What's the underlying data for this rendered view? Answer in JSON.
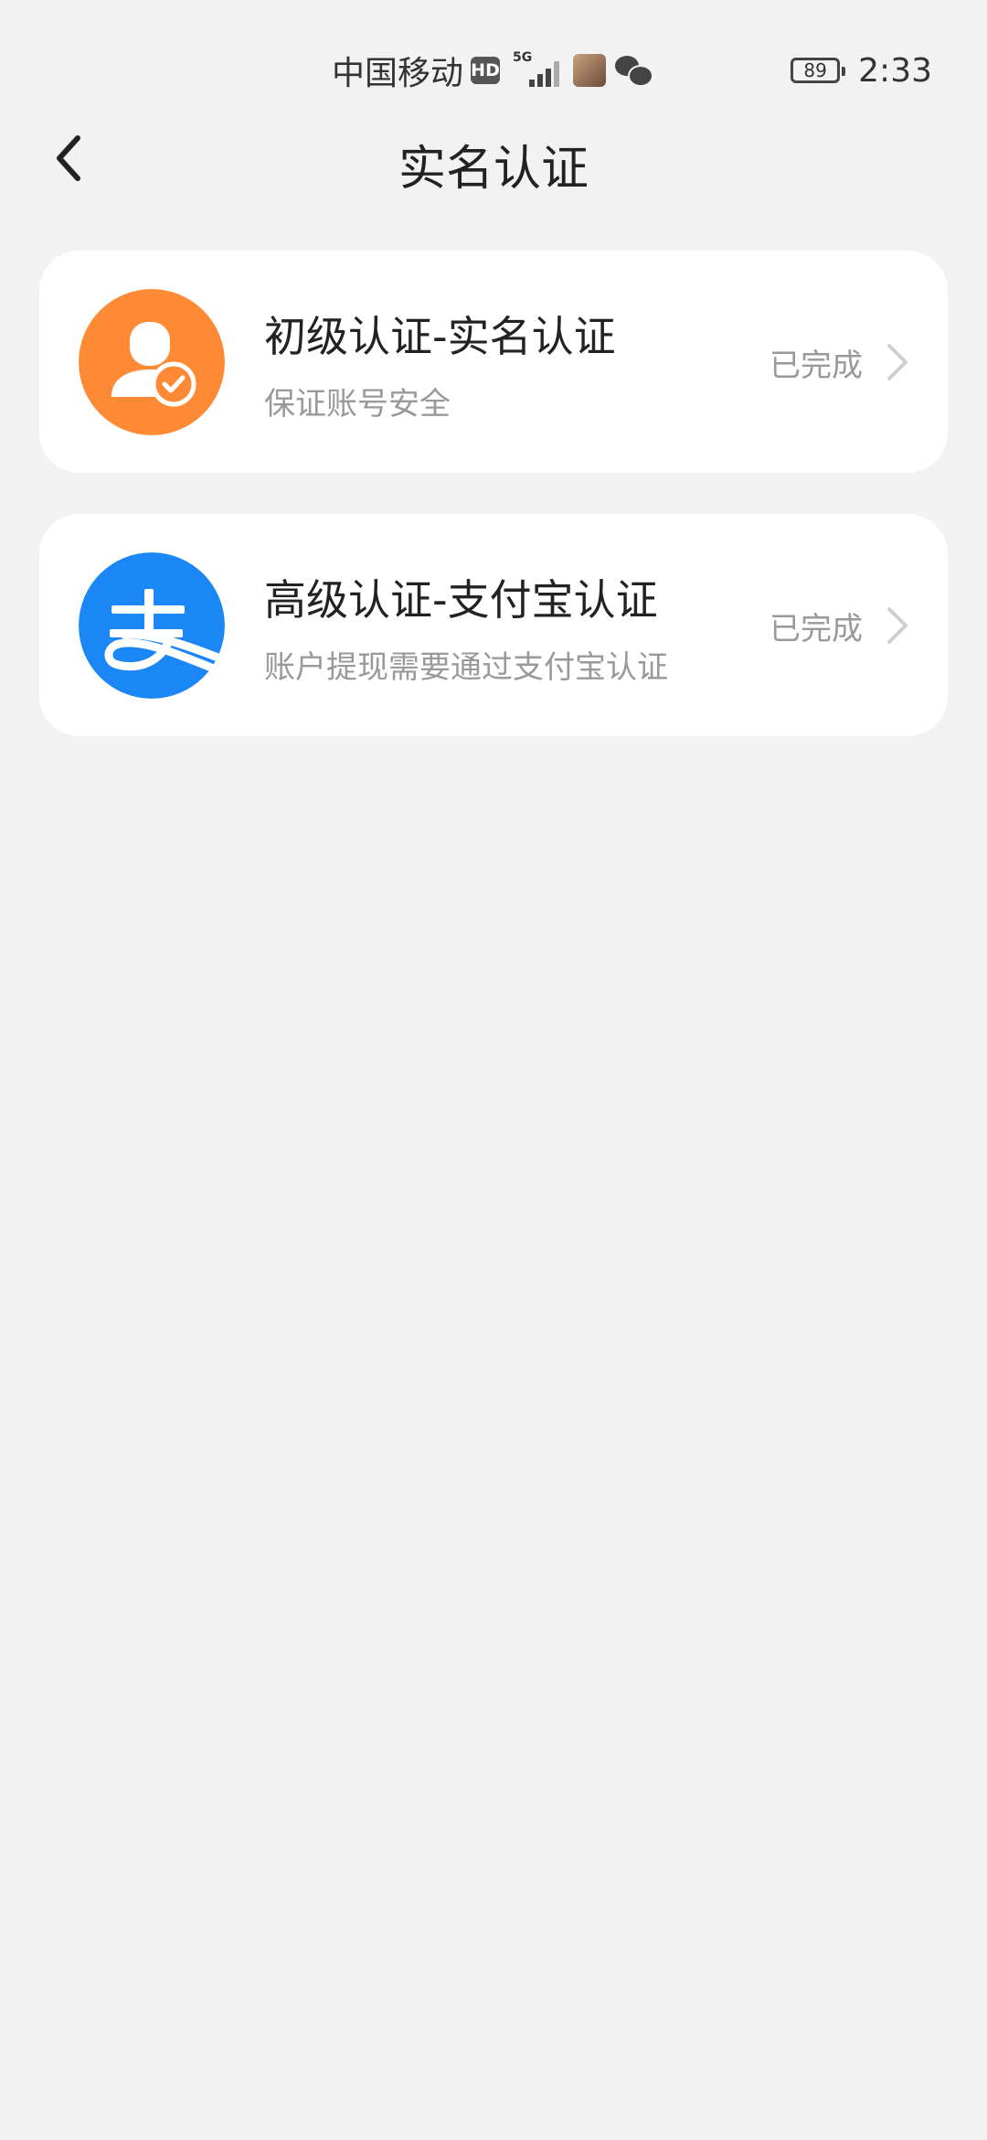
{
  "status_bar": {
    "carrier": "中国移动",
    "hd": "HD",
    "network": "5G",
    "battery": "89",
    "time": "2:33"
  },
  "header": {
    "title": "实名认证"
  },
  "items": [
    {
      "title": "初级认证-实名认证",
      "subtitle": "保证账号安全",
      "status": "已完成",
      "icon": "user-verified-icon",
      "color": "#ff8a35"
    },
    {
      "title": "高级认证-支付宝认证",
      "subtitle": "账户提现需要通过支付宝认证",
      "status": "已完成",
      "icon": "alipay-icon",
      "color": "#1b87f7"
    }
  ]
}
